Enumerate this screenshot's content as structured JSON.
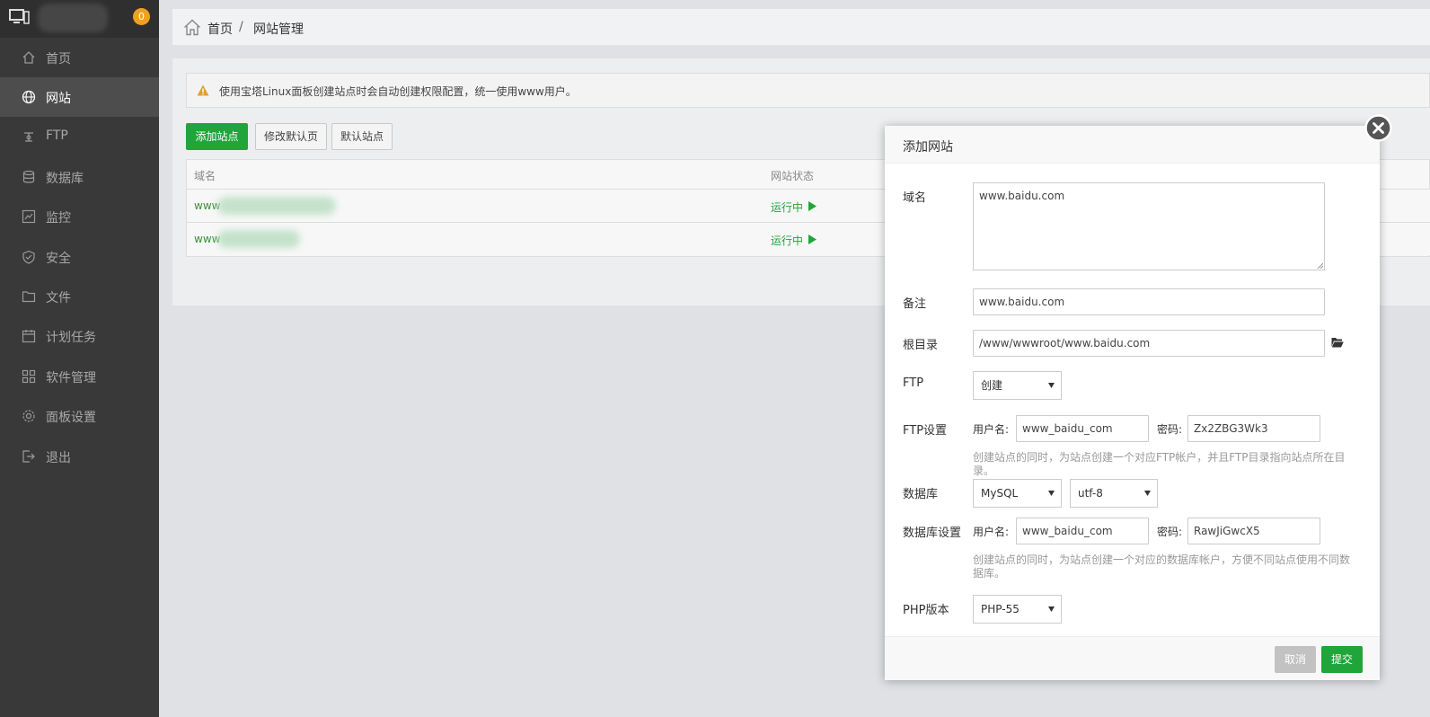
{
  "sidebar": {
    "badge_count": "0",
    "items": [
      {
        "label": "首页",
        "icon": "home-icon"
      },
      {
        "label": "网站",
        "icon": "globe-icon"
      },
      {
        "label": "FTP",
        "icon": "ftp-icon"
      },
      {
        "label": "数据库",
        "icon": "database-icon"
      },
      {
        "label": "监控",
        "icon": "monitor-chart-icon"
      },
      {
        "label": "安全",
        "icon": "shield-icon"
      },
      {
        "label": "文件",
        "icon": "folder-icon"
      },
      {
        "label": "计划任务",
        "icon": "calendar-icon"
      },
      {
        "label": "软件管理",
        "icon": "apps-grid-icon"
      },
      {
        "label": "面板设置",
        "icon": "gear-icon"
      },
      {
        "label": "退出",
        "icon": "logout-icon"
      }
    ]
  },
  "breadcrumb": {
    "home": "首页",
    "separator": "/",
    "current": "网站管理"
  },
  "notice": {
    "text": "使用宝塔Linux面板创建站点时会自动创建权限配置，统一使用www用户。"
  },
  "toolbar": {
    "add_site": "添加站点",
    "edit_default_page": "修改默认页",
    "default_site": "默认站点"
  },
  "table": {
    "headers": {
      "domain": "域名",
      "status": "网站状态"
    },
    "rows": [
      {
        "domain_prefix": "www",
        "status": "运行中"
      },
      {
        "domain_prefix": "www",
        "status": "运行中"
      }
    ]
  },
  "dialog": {
    "title": "添加网站",
    "domain": {
      "label": "域名",
      "value": "www.baidu.com"
    },
    "remark": {
      "label": "备注",
      "value": "www.baidu.com"
    },
    "root": {
      "label": "根目录",
      "value": "/www/wwwroot/www.baidu.com"
    },
    "ftp": {
      "label": "FTP",
      "selected": "创建"
    },
    "ftp_settings": {
      "label": "FTP设置",
      "user_label": "用户名:",
      "user_value": "www_baidu_com",
      "pass_label": "密码:",
      "pass_value": "Zx2ZBG3Wk3",
      "hint": "创建站点的同时，为站点创建一个对应FTP帐户，并且FTP目录指向站点所在目录。"
    },
    "database": {
      "label": "数据库",
      "type_selected": "MySQL",
      "charset_selected": "utf-8"
    },
    "db_settings": {
      "label": "数据库设置",
      "user_label": "用户名:",
      "user_value": "www_baidu_com",
      "pass_label": "密码:",
      "pass_value": "RawJiGwcX5",
      "hint": "创建站点的同时，为站点创建一个对应的数据库帐户，方便不同站点使用不同数据库。"
    },
    "php": {
      "label": "PHP版本",
      "selected": "PHP-55"
    },
    "cancel": "取消",
    "submit": "提交"
  },
  "colors": {
    "accent": "#20a53a",
    "sidebar_bg": "#393939",
    "badge": "#f0a020",
    "warning": "#e0a030"
  }
}
